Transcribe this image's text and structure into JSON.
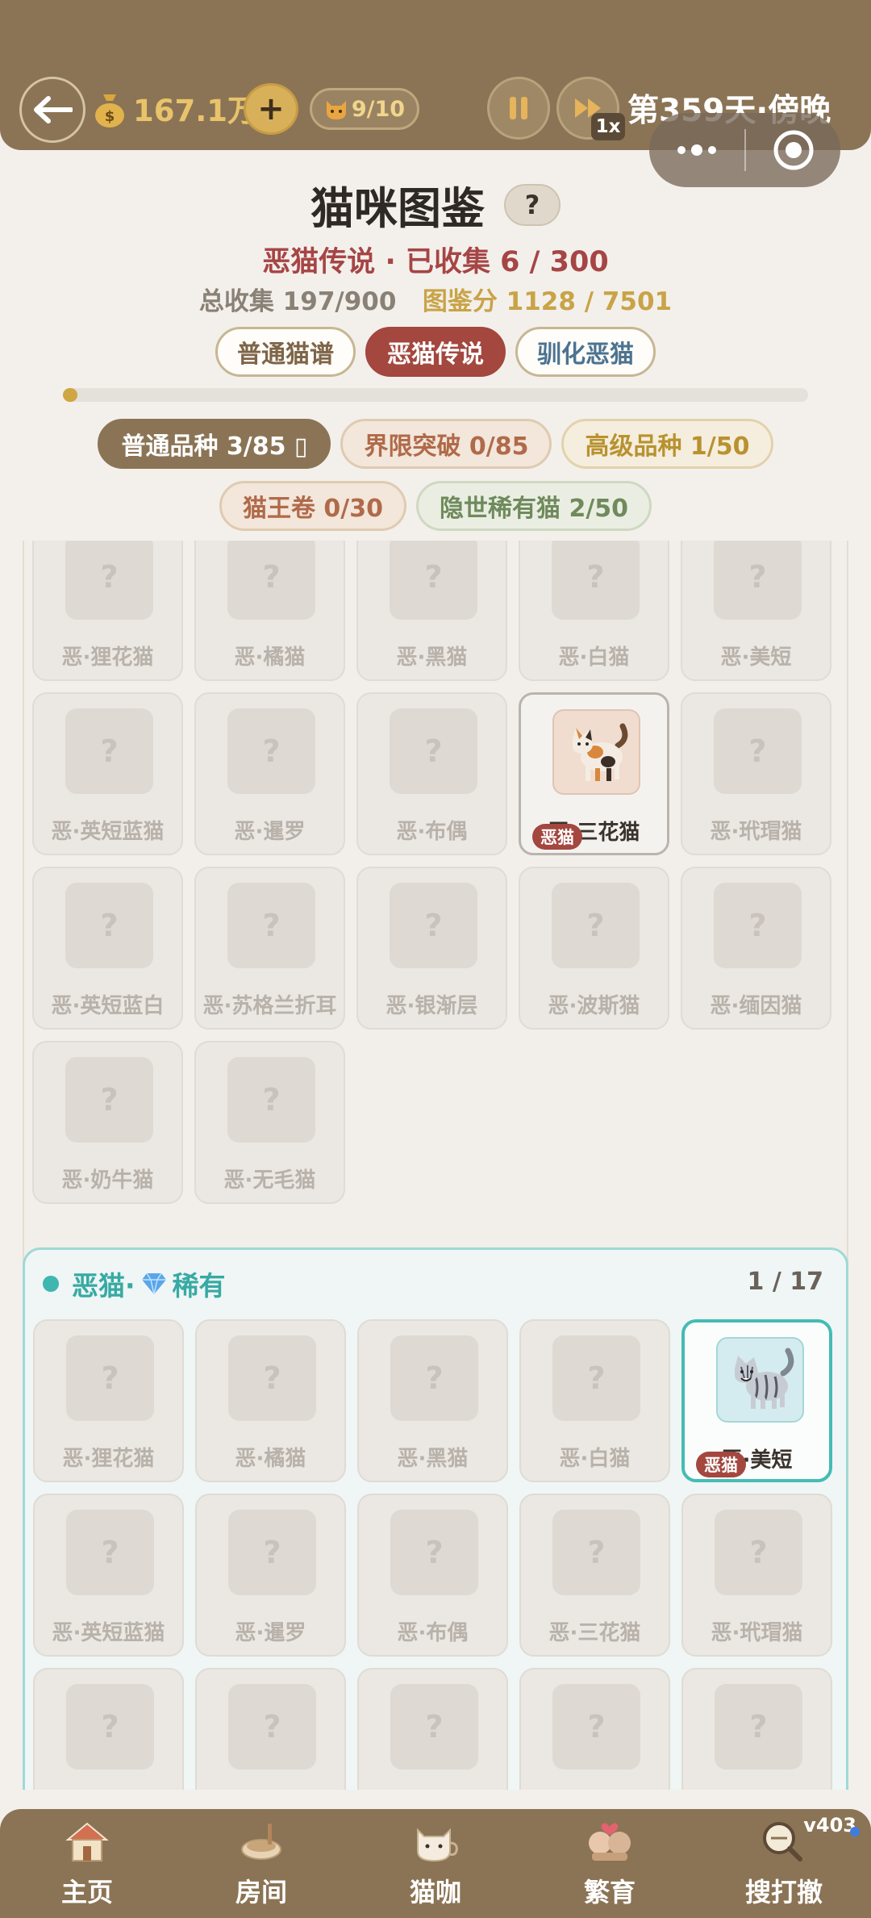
{
  "topbar": {
    "coins": "167.1万",
    "plus_label": "+",
    "cat_count": "9/10",
    "speed": "1x",
    "day": "第359天·傍晚"
  },
  "header": {
    "title": "猫咪图鉴",
    "help": "?",
    "subtitle": "恶猫传说 · 已收集 6 / 300",
    "total_label": "总收集 197/900",
    "score_label": "图鉴分 1128 / 7501"
  },
  "mode_tabs": [
    {
      "label": "普通猫谱"
    },
    {
      "label": "恶猫传说"
    },
    {
      "label": "驯化恶猫"
    }
  ],
  "progress": {
    "fraction": 0.02
  },
  "filters": [
    {
      "label": "普通品种 3/85 ▯"
    },
    {
      "label": "界限突破 0/85"
    },
    {
      "label": "高级品种 1/50"
    },
    {
      "label": "猫王卷 0/30"
    },
    {
      "label": "隐世稀有猫 2/50"
    }
  ],
  "common_section": {
    "cards": [
      {
        "name": "恶·狸花猫",
        "slot": "?"
      },
      {
        "name": "恶·橘猫",
        "slot": "?"
      },
      {
        "name": "恶·黑猫",
        "slot": "?"
      },
      {
        "name": "恶·白猫",
        "slot": "?"
      },
      {
        "name": "恶·美短",
        "slot": "?"
      },
      {
        "name": "恶·英短蓝猫",
        "slot": "?"
      },
      {
        "name": "恶·暹罗",
        "slot": "?"
      },
      {
        "name": "恶·布偶",
        "slot": "?"
      },
      {
        "name": "恶·三花猫",
        "tag": "恶猫",
        "unlocked": true
      },
      {
        "name": "恶·玳瑁猫",
        "slot": "?"
      },
      {
        "name": "恶·英短蓝白",
        "slot": "?"
      },
      {
        "name": "恶·苏格兰折耳",
        "slot": "?"
      },
      {
        "name": "恶·银渐层",
        "slot": "?"
      },
      {
        "name": "恶·波斯猫",
        "slot": "?"
      },
      {
        "name": "恶·缅因猫",
        "slot": "?"
      },
      {
        "name": "恶·奶牛猫",
        "slot": "?"
      },
      {
        "name": "恶·无毛猫",
        "slot": "?"
      }
    ]
  },
  "rare_section": {
    "title_prefix": "恶猫·",
    "title_suffix": "稀有",
    "count": "1 / 17",
    "cards": [
      {
        "name": "恶·狸花猫",
        "slot": "?"
      },
      {
        "name": "恶·橘猫",
        "slot": "?"
      },
      {
        "name": "恶·黑猫",
        "slot": "?"
      },
      {
        "name": "恶·白猫",
        "slot": "?"
      },
      {
        "name": "恶·美短",
        "tag": "恶猫",
        "unlocked": true
      },
      {
        "name": "恶·英短蓝猫",
        "slot": "?"
      },
      {
        "name": "恶·暹罗",
        "slot": "?"
      },
      {
        "name": "恶·布偶",
        "slot": "?"
      },
      {
        "name": "恶·三花猫",
        "slot": "?"
      },
      {
        "name": "恶·玳瑁猫",
        "slot": "?"
      },
      {
        "name": "",
        "slot": "?"
      },
      {
        "name": "",
        "slot": "?"
      },
      {
        "name": "",
        "slot": "?"
      },
      {
        "name": "",
        "slot": "?"
      },
      {
        "name": "",
        "slot": "?"
      }
    ]
  },
  "nav": {
    "items": [
      {
        "label": "主页",
        "icon": "house-icon"
      },
      {
        "label": "房间",
        "icon": "room-icon"
      },
      {
        "label": "猫咖",
        "icon": "cat-cafe-icon"
      },
      {
        "label": "繁育",
        "icon": "breeding-icon"
      },
      {
        "label": "搜打撤",
        "icon": "search-raid-icon"
      }
    ],
    "version": "v403"
  },
  "colors": {
    "bar_brown": "#8b7455",
    "accent_red": "#a3473f",
    "rare_teal": "#45bbb5",
    "gold": "#d0a544"
  }
}
